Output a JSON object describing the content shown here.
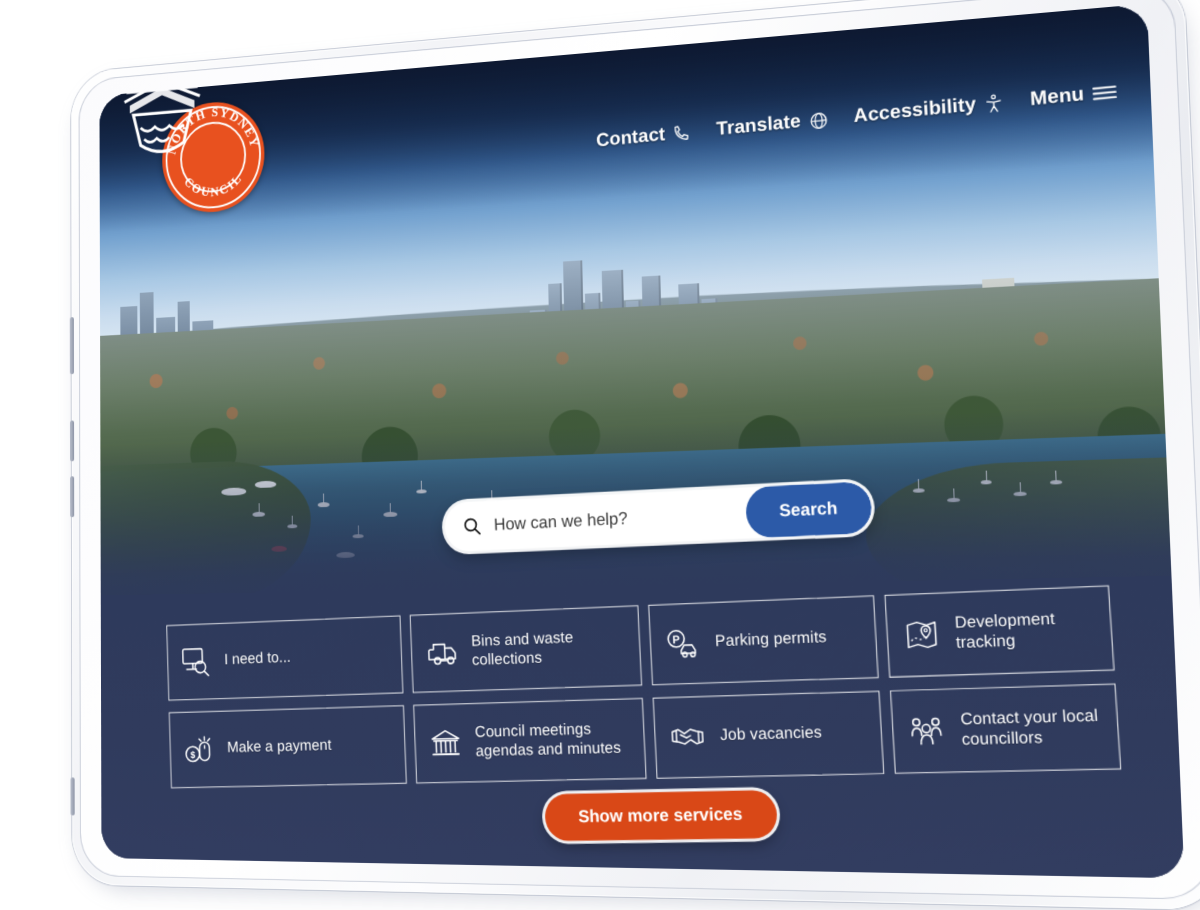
{
  "site": {
    "organization": "North Sydney Council",
    "logo": {
      "top_arc_text": "NORTH SYDNEY",
      "bottom_arc_text": "COUNCIL",
      "color": "#e8511f"
    }
  },
  "header": {
    "nav": [
      {
        "label": "Contact",
        "icon": "phone-icon"
      },
      {
        "label": "Translate",
        "icon": "globe-icon"
      },
      {
        "label": "Accessibility",
        "icon": "accessibility-icon"
      },
      {
        "label": "Menu",
        "icon": "hamburger-menu-icon"
      }
    ]
  },
  "hero": {
    "image_description": "Aerial photograph of North Sydney harbour with moored sailboats, tree-covered suburbs and the North Sydney CBD skyline under a clear blue sky"
  },
  "search": {
    "icon": "search-icon",
    "placeholder": "How can we help?",
    "value": "",
    "button_label": "Search",
    "button_color": "#2c5aa8"
  },
  "services": {
    "tiles": [
      {
        "label": "I need to...",
        "icon": "monitor-search-icon"
      },
      {
        "label": "Bins and waste\ncollections",
        "icon": "garbage-truck-icon"
      },
      {
        "label": "Parking permits",
        "icon": "parking-car-icon"
      },
      {
        "label": "Development tracking",
        "icon": "map-pin-icon"
      },
      {
        "label": "Make a payment",
        "icon": "coin-mouse-icon"
      },
      {
        "label": "Council meetings\nagendas and minutes",
        "icon": "government-building-icon"
      },
      {
        "label": "Job vacancies",
        "icon": "handshake-icon"
      },
      {
        "label": "Contact your local\ncouncillors",
        "icon": "people-group-icon"
      }
    ],
    "show_more_label": "Show more services",
    "show_more_color": "#d94817"
  },
  "theme": {
    "panel_navy": "#2e3a5c",
    "accent_orange": "#d94817",
    "accent_blue": "#2c5aa8",
    "text_on_dark": "#ffffff"
  }
}
